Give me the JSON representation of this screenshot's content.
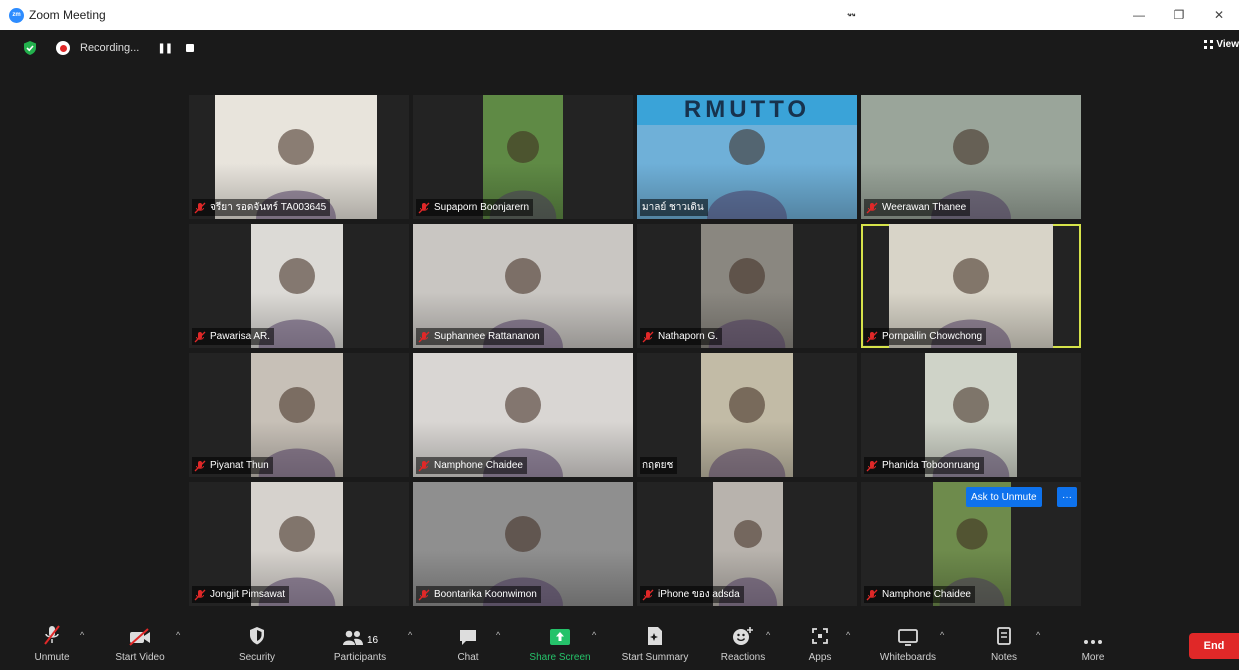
{
  "window": {
    "title": "Zoom Meeting",
    "logo_text": "zm",
    "title_mark": "ู      ู",
    "controls": [
      "—",
      "❐",
      "✕"
    ]
  },
  "topbar": {
    "recording_label": "Recording...",
    "pause_symbol": "❚❚",
    "view_label": "View"
  },
  "participants": [
    {
      "name": "จรียา รอดจันทร์ TA003645",
      "muted": true,
      "bg": "#e8e4dc"
    },
    {
      "name": "Supaporn Boonjarern",
      "muted": true,
      "bg": "#5f8a45"
    },
    {
      "name": "มาลย์ ชาวเดิน",
      "muted": false,
      "bg": "#6fb0d8"
    },
    {
      "name": "Weerawan Thanee",
      "muted": true,
      "bg": "#9aa59a"
    },
    {
      "name": "Pawarisa AR.",
      "muted": true,
      "bg": "#dcdad6"
    },
    {
      "name": "Suphannee Rattananon",
      "muted": true,
      "bg": "#c9c6c2"
    },
    {
      "name": "Nathaporn G.",
      "muted": true,
      "bg": "#8a8780"
    },
    {
      "name": "Pornpailin Chowchong",
      "muted": true,
      "bg": "#d8d4c8"
    },
    {
      "name": "Piyanat Thun",
      "muted": true,
      "bg": "#c7c0b7"
    },
    {
      "name": "Namphone Chaidee",
      "muted": true,
      "bg": "#d9d6d3"
    },
    {
      "name": "กฤตยช",
      "muted": false,
      "bg": "#c2bba6"
    },
    {
      "name": "Phanida Toboonruang",
      "muted": true,
      "bg": "#cfd3c8"
    },
    {
      "name": "Jongjit Pimsawat",
      "muted": true,
      "bg": "#d6d2cd"
    },
    {
      "name": "Boontarika Koonwimon",
      "muted": true,
      "bg": "#8f8f8f"
    },
    {
      "name": "iPhone ของ adsda",
      "muted": true,
      "bg": "#b8b3ad"
    },
    {
      "name": "Namphone Chaidee",
      "muted": true,
      "bg": "#6e8b4c"
    }
  ],
  "rmutto_banner": "RMUTTO",
  "ask_unmute": {
    "label": "Ask to Unmute",
    "more": "···"
  },
  "toolbar": {
    "unmute": "Unmute",
    "start_video": "Start Video",
    "security": "Security",
    "participants": "Participants",
    "participant_count": "16",
    "chat": "Chat",
    "share_screen": "Share Screen",
    "start_summary": "Start Summary",
    "reactions": "Reactions",
    "apps": "Apps",
    "whiteboards": "Whiteboards",
    "notes": "Notes",
    "more": "More",
    "end": "End",
    "caret": "^"
  },
  "colors": {
    "accent_blue": "#0e72ed",
    "end_red": "#e02828",
    "share_green": "#25c26a",
    "active_speaker": "#d6e34a"
  }
}
